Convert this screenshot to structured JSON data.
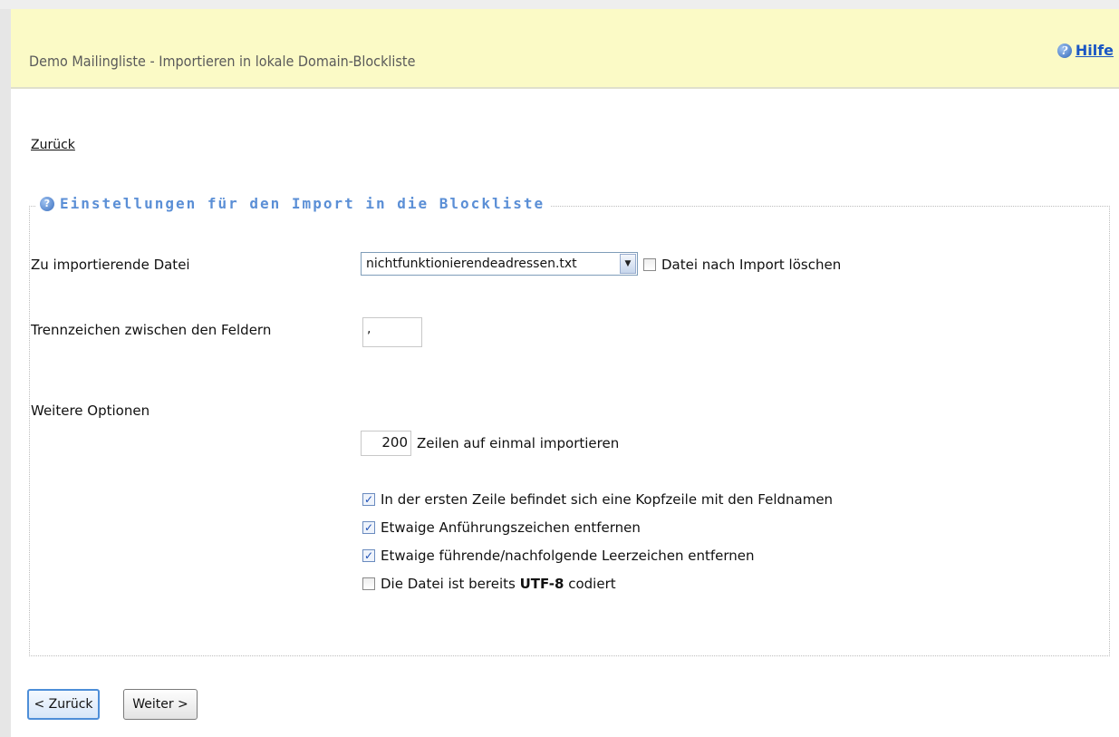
{
  "header": {
    "title": "Demo Mailingliste - Importieren in lokale Domain-Blockliste",
    "help_label": "Hilfe"
  },
  "back_link": "Zurück",
  "section": {
    "legend": "Einstellungen für den Import in die Blockliste",
    "file_label": "Zu importierende Datei",
    "file_selected": "nichtfunktionierendeadressen.txt",
    "delete_after_import_label": "Datei nach Import löschen",
    "delete_after_import_checked": false,
    "separator_label": "Trennzeichen zwischen den Feldern",
    "separator_value": ",",
    "more_options_label": "Weitere Optionen",
    "rows_value": "200",
    "rows_label": "Zeilen auf einmal importieren",
    "options": [
      {
        "label": "In der ersten Zeile befindet sich eine Kopfzeile mit den Feldnamen",
        "checked": true
      },
      {
        "label": "Etwaige Anführungszeichen entfernen",
        "checked": true
      },
      {
        "label": "Etwaige führende/nachfolgende Leerzeichen entfernen",
        "checked": true
      },
      {
        "label_prefix": "Die Datei ist bereits ",
        "label_bold": "UTF-8",
        "label_suffix": " codiert",
        "checked": false
      }
    ]
  },
  "buttons": {
    "back": "< Zurück",
    "next": "Weiter >"
  },
  "icons": {
    "help": "help-icon",
    "legend": "info-icon",
    "dropdown": "chevron-down-icon",
    "check": "checkmark-icon"
  },
  "colors": {
    "header_bg": "#fbfac6",
    "link_blue": "#1a56c4",
    "legend_blue": "#5b8fd6"
  }
}
